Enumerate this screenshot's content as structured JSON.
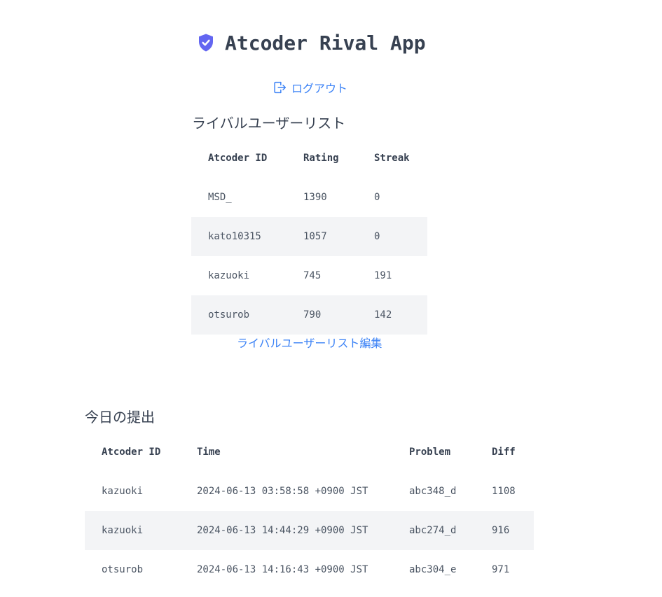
{
  "app": {
    "title": "Atcoder Rival App",
    "logout_label": "ログアウト"
  },
  "colors": {
    "accent": "#3b82f6",
    "shield": "#6366f1",
    "row_alt": "#f3f4f6",
    "text": "#4b5563"
  },
  "icons": {
    "brand": "shield-check-icon",
    "logout": "logout-icon"
  },
  "rivals": {
    "title": "ライバルユーザーリスト",
    "columns": [
      "Atcoder ID",
      "Rating",
      "Streak"
    ],
    "rows": [
      [
        "MSD_",
        "1390",
        "0"
      ],
      [
        "kato10315",
        "1057",
        "0"
      ],
      [
        "kazuoki",
        "745",
        "191"
      ],
      [
        "otsurob",
        "790",
        "142"
      ]
    ],
    "edit_label": "ライバルユーザーリスト編集"
  },
  "submissions": {
    "title": "今日の提出",
    "columns": [
      "Atcoder ID",
      "Time",
      "Problem",
      "Diff"
    ],
    "rows": [
      [
        "kazuoki",
        "2024-06-13 03:58:58 +0900 JST",
        "abc348_d",
        "1108"
      ],
      [
        "kazuoki",
        "2024-06-13 14:44:29 +0900 JST",
        "abc274_d",
        "916"
      ],
      [
        "otsurob",
        "2024-06-13 14:16:43 +0900 JST",
        "abc304_e",
        "971"
      ]
    ]
  }
}
